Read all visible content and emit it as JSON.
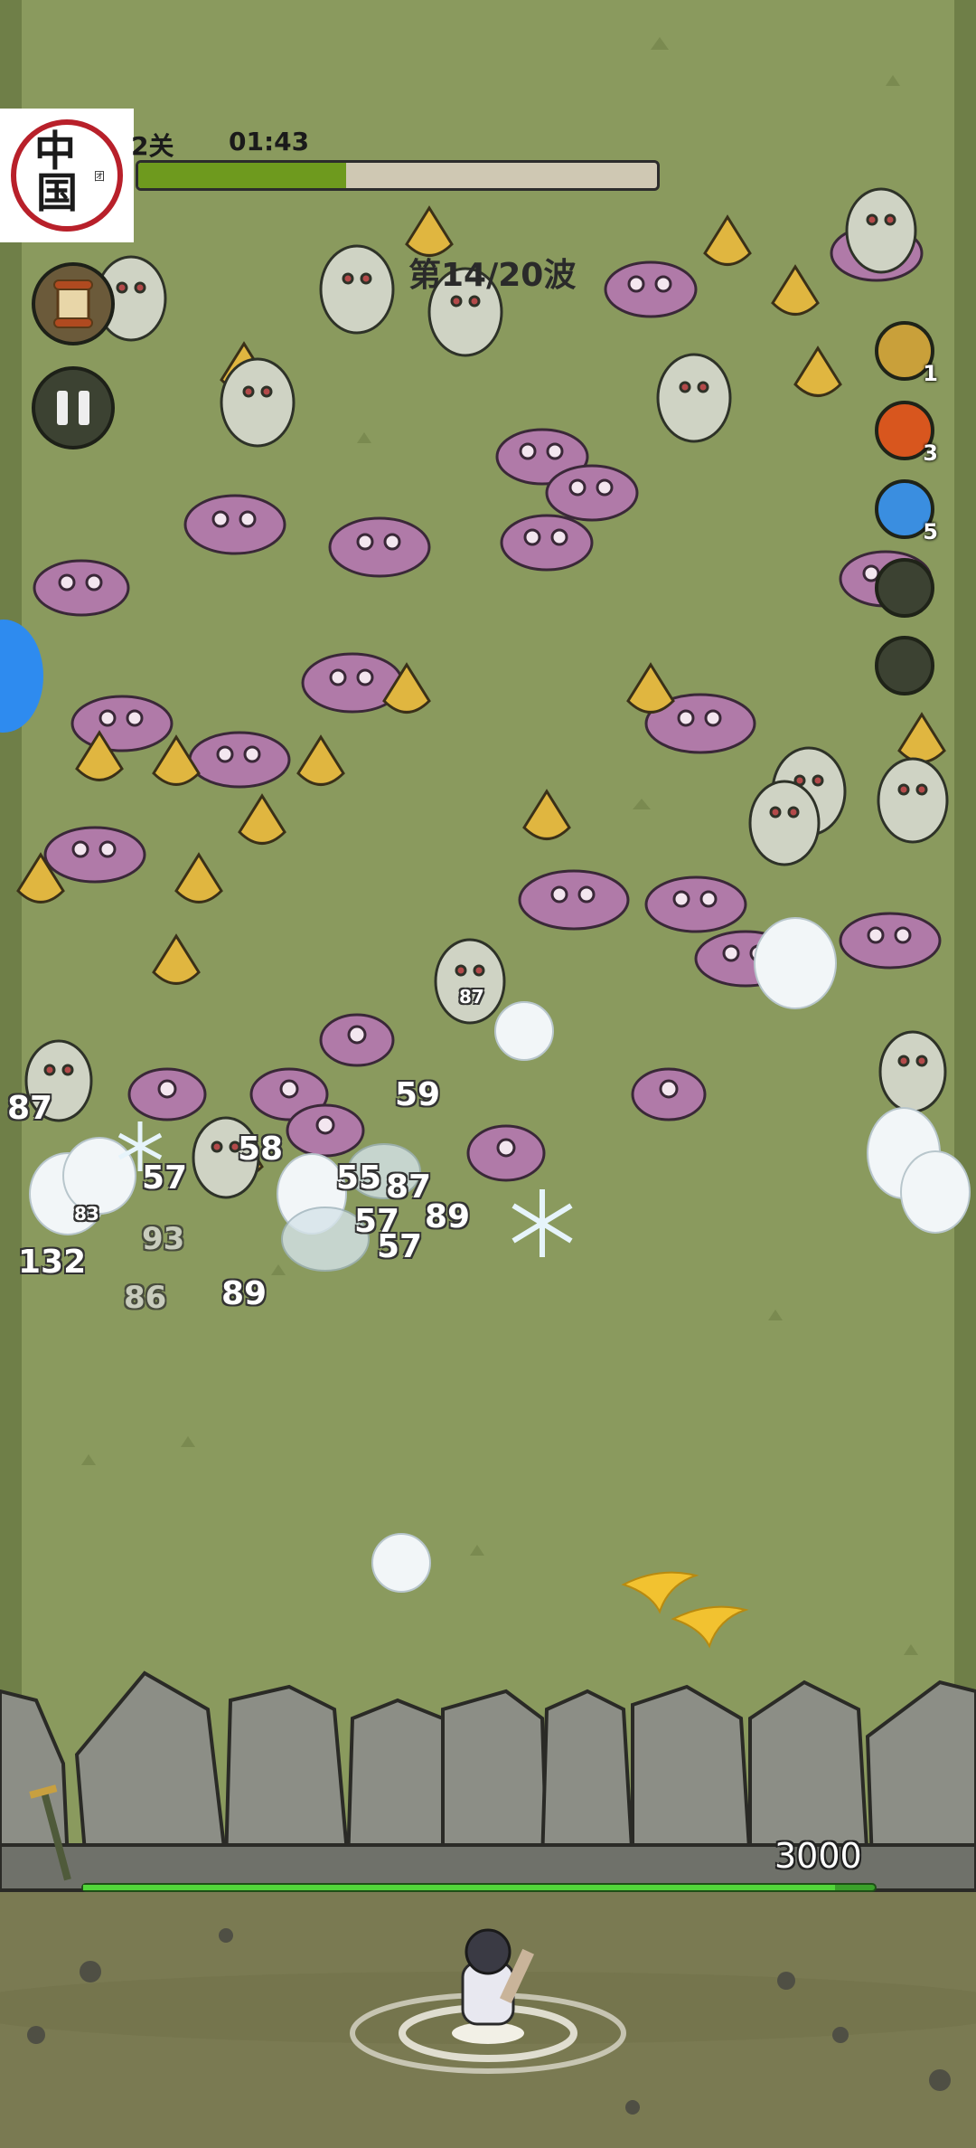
{
  "hud": {
    "stage_label": "2关",
    "timer": "01:43",
    "stage_progress": 0.4,
    "wave_label": "第14/20波"
  },
  "logo": {
    "char_top": "中",
    "char_bottom": "国",
    "side_text": "团"
  },
  "buttons": {
    "scroll": "scroll-icon",
    "pause": "pause-icon"
  },
  "skills": [
    {
      "icon": "sword-skill-icon",
      "count": "1",
      "color": "#c9a03a"
    },
    {
      "icon": "fire-skill-icon",
      "count": "3",
      "color": "#d8561e"
    },
    {
      "icon": "ice-skill-icon",
      "count": "5",
      "color": "#3a8ee0"
    },
    {
      "icon": "locked-skill-icon",
      "count": "",
      "color": "#3c4232"
    },
    {
      "icon": "locked-skill-icon",
      "count": "",
      "color": "#3c4232"
    }
  ],
  "damage_numbers": [
    {
      "text": "87",
      "faded": false
    },
    {
      "text": "59",
      "faded": false
    },
    {
      "text": "58",
      "faded": false
    },
    {
      "text": "57",
      "faded": false
    },
    {
      "text": "55",
      "faded": false
    },
    {
      "text": "87",
      "faded": false
    },
    {
      "text": "57",
      "faded": false
    },
    {
      "text": "89",
      "faded": false
    },
    {
      "text": "57",
      "faded": false
    },
    {
      "text": "132",
      "faded": false
    },
    {
      "text": "93",
      "faded": true
    },
    {
      "text": "86",
      "faded": true
    },
    {
      "text": "89",
      "faded": false
    },
    {
      "text": "83",
      "faded": false
    },
    {
      "text": "87",
      "faded": false
    }
  ],
  "wall": {
    "hp_text": "3000",
    "hp_fraction": 0.95
  },
  "colors": {
    "grass": "#8a9a5e",
    "dirt": "#7a7a52",
    "stone": "#8c8e86",
    "pink_bird": "#b07aa8",
    "yellow_bird": "#e0b640",
    "ghost": "#cfd3c4"
  }
}
